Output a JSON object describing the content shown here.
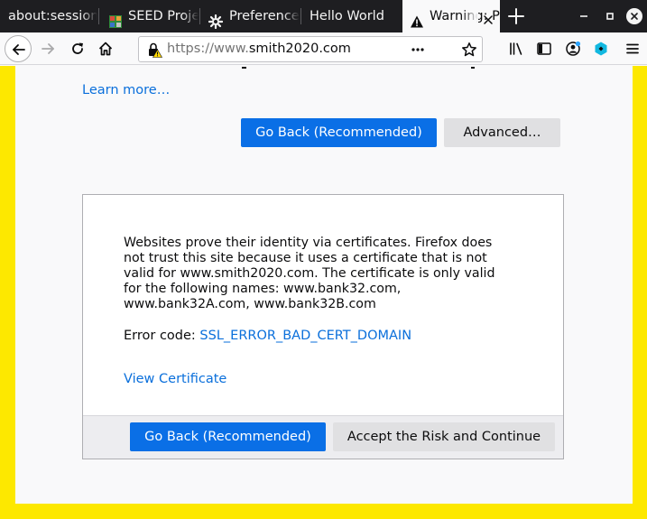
{
  "tabs": [
    {
      "label": "about:sessionrestore",
      "active": false
    },
    {
      "label": "SEED Project",
      "active": false
    },
    {
      "label": "Preferences",
      "active": false
    },
    {
      "label": "Hello World",
      "active": false
    },
    {
      "label": "Warning: Potential Security Risk Ahead",
      "active": true
    }
  ],
  "url": {
    "prefix": "https://www.",
    "domain": "smith2020.com"
  },
  "icons": {
    "tab_seed": "seed-project-favicon",
    "tab_prefs": "gear-icon",
    "tab_warning": "warning-icon",
    "security": "insecure-lock-icon"
  },
  "colors": {
    "accent": "#0a6fe6",
    "link": "#0a6fdb",
    "frame": "#fde800"
  },
  "top": {
    "learn_more": "Learn more…",
    "go_back": "Go Back (Recommended)",
    "advanced": "Advanced…"
  },
  "details": {
    "description": "Websites prove their identity via certificates. Firefox does not trust this site because it uses a certificate that is not valid for www.smith2020.com. The certificate is only valid for the following names: www.bank32.com, www.bank32A.com, www.bank32B.com",
    "error_label": "Error code: ",
    "error_code": "SSL_ERROR_BAD_CERT_DOMAIN",
    "view_certificate": "View Certificate",
    "go_back": "Go Back (Recommended)",
    "accept": "Accept the Risk and Continue"
  }
}
